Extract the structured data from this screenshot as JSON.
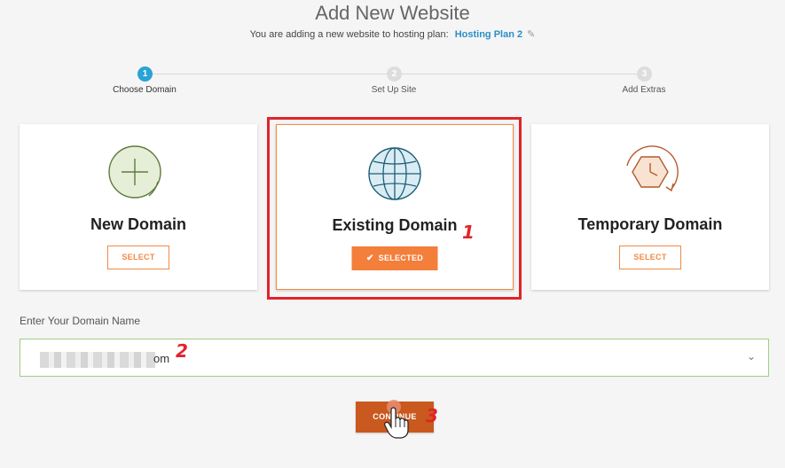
{
  "header": {
    "title": "Add New Website",
    "subtitle_prefix": "You are adding a new website to hosting plan:",
    "plan_name": "Hosting Plan 2",
    "edit_icon": "pencil-icon"
  },
  "steps": [
    {
      "number": "1",
      "label": "Choose Domain",
      "active": true
    },
    {
      "number": "2",
      "label": "Set Up Site",
      "active": false
    },
    {
      "number": "3",
      "label": "Add Extras",
      "active": false
    }
  ],
  "cards": {
    "new": {
      "title": "New Domain",
      "button": "SELECT",
      "icon": "plus-circle-icon"
    },
    "existing": {
      "title": "Existing Domain",
      "button": "SELECTED",
      "icon": "globe-icon",
      "selected": true
    },
    "temporary": {
      "title": "Temporary Domain",
      "button": "SELECT",
      "icon": "clock-icon"
    }
  },
  "domain": {
    "label": "Enter Your Domain Name",
    "value_visible_suffix": "om"
  },
  "continue_label": "CONTINUE",
  "annotations": {
    "one": "1",
    "two": "2",
    "three": "3"
  },
  "colors": {
    "accent_orange": "#f37f3b",
    "step_active": "#29a3d6",
    "annotation_red": "#e0242a",
    "link_blue": "#2a8fc6"
  }
}
